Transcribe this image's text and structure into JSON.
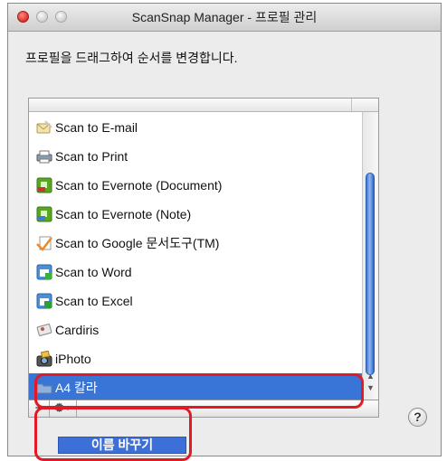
{
  "window": {
    "title": "ScanSnap Manager - 프로필 관리"
  },
  "instruction": "프로필을 드래그하여 순서를 변경합니다.",
  "profiles": [
    {
      "label": "Scan to E-mail",
      "icon": "email-icon"
    },
    {
      "label": "Scan to Print",
      "icon": "printer-icon"
    },
    {
      "label": "Scan to Evernote (Document)",
      "icon": "evernote-pdf-icon"
    },
    {
      "label": "Scan to Evernote (Note)",
      "icon": "evernote-jpg-icon"
    },
    {
      "label": "Scan to Google 문서도구(TM)",
      "icon": "google-docs-icon"
    },
    {
      "label": "Scan to Word",
      "icon": "word-icon"
    },
    {
      "label": "Scan to Excel",
      "icon": "excel-icon"
    },
    {
      "label": "Cardiris",
      "icon": "cardiris-icon"
    },
    {
      "label": "iPhoto",
      "icon": "iphoto-icon"
    },
    {
      "label": "A4 칼라",
      "icon": "folder-icon",
      "selected": true
    }
  ],
  "toolbar": {
    "minus_label": "−"
  },
  "help_label": "?",
  "context_menu": {
    "rename_label": "이름 바꾸기"
  },
  "colors": {
    "selection": "#3875d7",
    "highlight": "#e21a25",
    "menu": "#3d6fd9"
  }
}
